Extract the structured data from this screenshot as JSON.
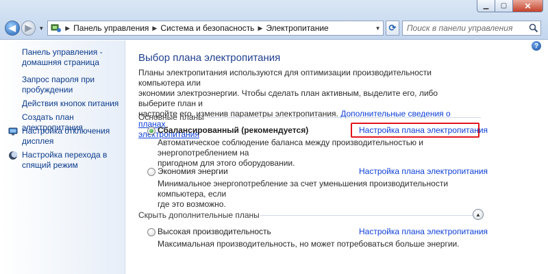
{
  "address": {
    "crumbs": [
      "Панель управления",
      "Система и безопасность",
      "Электропитание"
    ],
    "search_placeholder": "Поиск в панели управления"
  },
  "sidebar": {
    "items": [
      {
        "label_line1": "Панель управления -",
        "label_line2": "домашняя страница"
      },
      {
        "label_line1": "Запрос пароля при",
        "label_line2": "пробуждении"
      },
      {
        "label_line1": "Действия кнопок питания",
        "label_line2": ""
      },
      {
        "label_line1": "Создать план электропитания",
        "label_line2": ""
      },
      {
        "label_line1": "Настройка отключения",
        "label_line2": "дисплея",
        "icon": "display-icon"
      },
      {
        "label_line1": "Настройка перехода в",
        "label_line2": "спящий режим",
        "icon": "moon-icon"
      }
    ]
  },
  "main": {
    "title": "Выбор плана электропитания",
    "desc_line1": "Планы электропитания используются для оптимизации производительности компьютера или",
    "desc_line2": "экономии электроэнергии. Чтобы сделать план активным, выделите его, либо выберите план и",
    "desc_line3": "настройте его, изменив параметры электропитания.",
    "desc_link1": "Дополнительные сведения о планах",
    "desc_link2": "электропитания",
    "group_basic": "Основные планы",
    "group_hidden": "Скрыть дополнительные планы",
    "setup_label": "Настройка плана электропитания",
    "plans": [
      {
        "name": "Сбалансированный (рекомендуется)",
        "desc_line1": "Автоматическое соблюдение баланса между производительностью и энергопотреблением на",
        "desc_line2": "пригодном для этого оборудовании.",
        "selected": true
      },
      {
        "name": "Экономия энергии",
        "desc_line1": "Минимальное энергопотребление за счет уменьшения производительности компьютера, если",
        "desc_line2": "где это возможно.",
        "selected": false
      },
      {
        "name": "Высокая производительность",
        "desc_line1": "Максимальная производительность, но может потребоваться больше энергии.",
        "desc_line2": "",
        "selected": false
      }
    ]
  },
  "colors": {
    "link": "#0b3ed8",
    "title": "#1e3e8e",
    "highlight": "#e1141a"
  }
}
